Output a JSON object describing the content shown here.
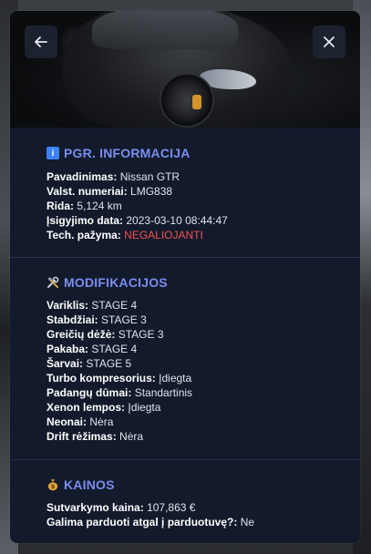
{
  "header": {
    "back_icon": "arrow-left-icon",
    "close_icon": "close-icon"
  },
  "info": {
    "icon": "info-icon",
    "title": "PGR. INFORMACIJA",
    "rows": [
      {
        "key": "Pavadinimas:",
        "value": "Nissan GTR"
      },
      {
        "key": "Valst. numeriai:",
        "value": "LMG838"
      },
      {
        "key": "Rida:",
        "value": "5,124 km"
      },
      {
        "key": "Įsigyjimo data:",
        "value": "2023-03-10 08:44:47"
      },
      {
        "key": "Tech. pažyma:",
        "value": "NEGALIOJANTI"
      }
    ],
    "status_color_bad": "#f05252"
  },
  "mods": {
    "icon": "tools-icon",
    "title": "MODIFIKACIJOS",
    "rows": [
      {
        "key": "Variklis:",
        "value": "STAGE 4"
      },
      {
        "key": "Stabdžiai:",
        "value": "STAGE 3"
      },
      {
        "key": "Greičių dėžė:",
        "value": "STAGE 3"
      },
      {
        "key": "Pakaba:",
        "value": "STAGE 4"
      },
      {
        "key": "Šarvai:",
        "value": "STAGE 5"
      },
      {
        "key": "Turbo kompresorius:",
        "value": "Įdiegta"
      },
      {
        "key": "Padangų dūmai:",
        "value": "Standartinis"
      },
      {
        "key": "Xenon lempos:",
        "value": "Įdiegta"
      },
      {
        "key": "Neonai:",
        "value": "Nėra"
      },
      {
        "key": "Drift rėžimas:",
        "value": "Nėra"
      }
    ]
  },
  "prices": {
    "icon": "money-bag-icon",
    "title": "KAINOS",
    "rows": [
      {
        "key": "Sutvarkymo kaina:",
        "value": "107,863 €"
      },
      {
        "key": "Galima parduoti atgal į parduotuvę?:",
        "value": "Ne"
      }
    ]
  },
  "colors": {
    "accent": "#7b8df0",
    "panel": "#121a2b"
  }
}
